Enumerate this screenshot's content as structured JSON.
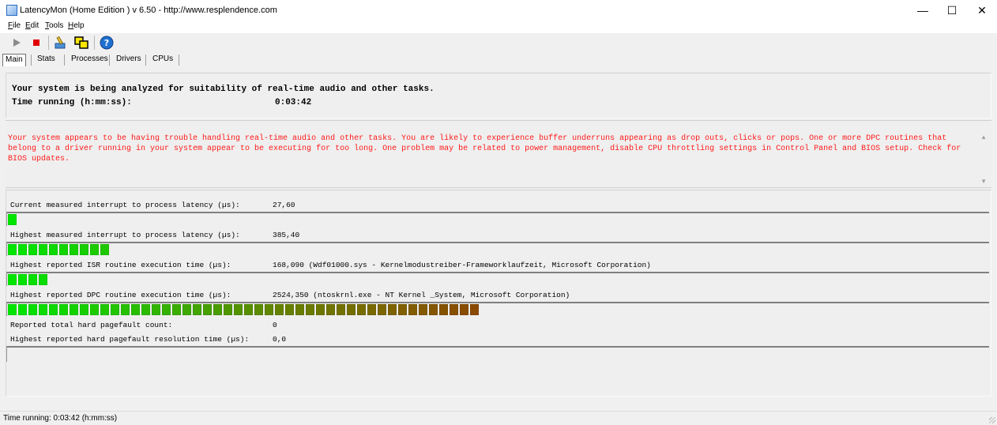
{
  "window": {
    "title": "LatencyMon  (Home Edition )  v 6.50 - http://www.resplendence.com",
    "minimize": "—",
    "maximize": "☐",
    "close": "✕"
  },
  "menu": {
    "items": [
      "File",
      "Edit",
      "Tools",
      "Help"
    ]
  },
  "toolbar": {
    "icons": [
      "play-icon",
      "stop-icon",
      "drivers-icon",
      "processors-icon",
      "help-icon"
    ],
    "colors": {
      "play": "#8c8c8c",
      "stop": "#e00000",
      "help": "#1f6fd1"
    }
  },
  "tabs": {
    "items": [
      "Main",
      "Stats",
      "Processes",
      "Drivers",
      "CPUs"
    ],
    "active": "Main"
  },
  "summary": {
    "analyzing": "Your system is being analyzed for suitability of real-time audio and other tasks.",
    "time_label": "Time running (h:mm:ss):",
    "time_value": "0:03:42"
  },
  "message": {
    "text": "Your system appears to be having trouble handling real-time audio and other tasks. You are likely to experience buffer underruns appearing as drop outs, clicks or pops. One or more DPC routines that belong to a driver running in your system appear to be executing for too long. One problem may be related to power management, disable CPU throttling settings in Control Panel and BIOS setup. Check for BIOS updates.",
    "color": "#ff1a1a"
  },
  "metrics": [
    {
      "label": "Current measured interrupt to process latency (µs):",
      "value": "27,60",
      "segments": 1
    },
    {
      "label": "Highest measured interrupt to process latency (µs):",
      "value": "385,40",
      "segments": 10
    },
    {
      "label": "Highest reported ISR routine execution time (µs):",
      "value": "168,090  (Wdf01000.sys - Kernelmodustreiber-Frameworklaufzeit, Microsoft Corporation)",
      "segments": 4
    },
    {
      "label": "Highest reported DPC routine execution time (µs):",
      "value": "2524,350  (ntoskrnl.exe - NT Kernel _System, Microsoft Corporation)",
      "segments": 46
    },
    {
      "label": "Reported total hard pagefault count:",
      "value": "0"
    },
    {
      "label": "Highest reported hard pagefault resolution time (µs):",
      "value": "0,0",
      "segments": 0
    }
  ],
  "status": {
    "text": "Time running: 0:03:42  (h:mm:ss)"
  }
}
